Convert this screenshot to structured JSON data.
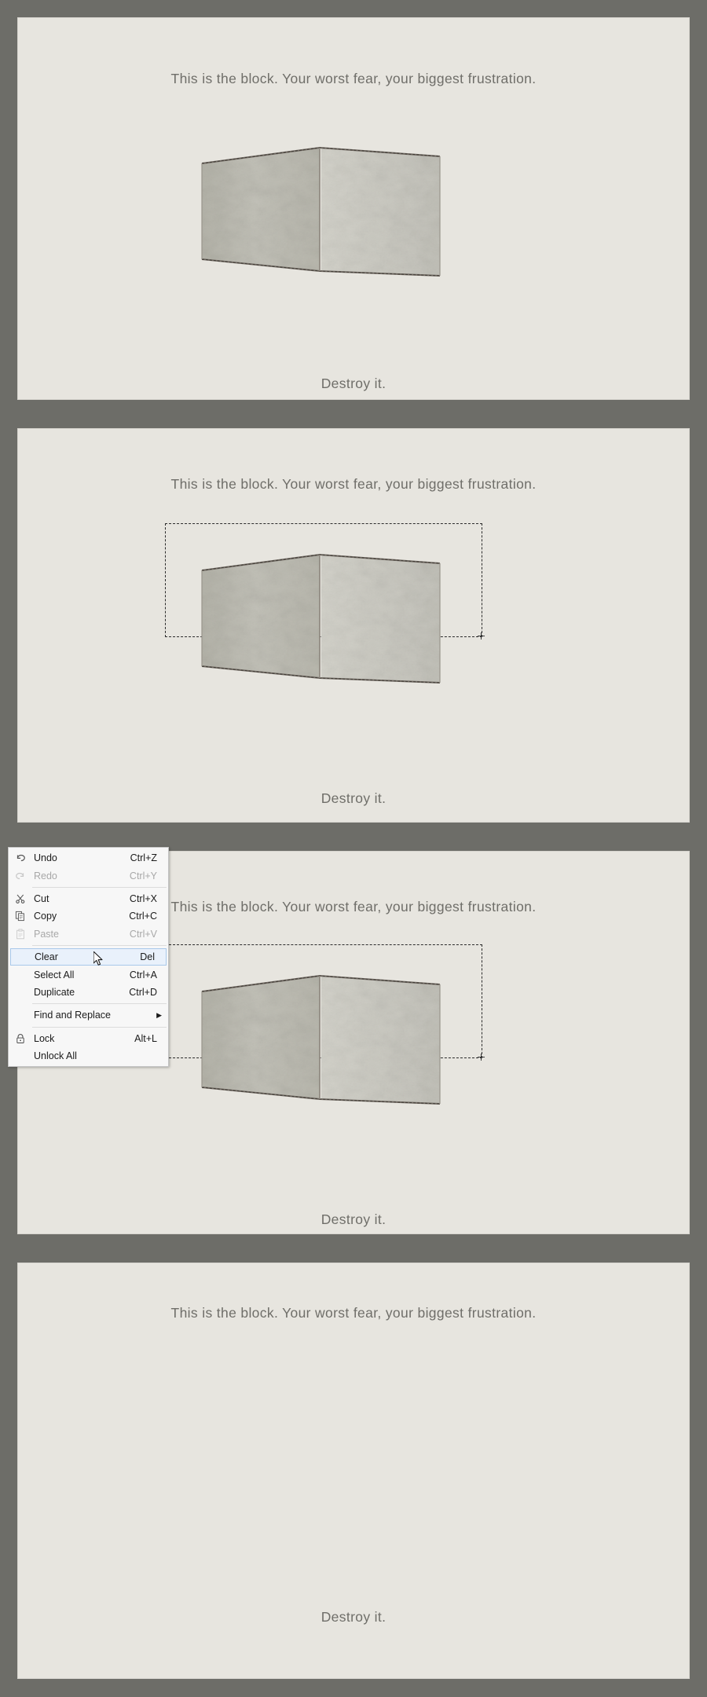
{
  "app": {
    "canvas_bg": "#e7e5df",
    "frame_bg": "#6d6d68",
    "text_color": "#6f6e69"
  },
  "panels": [
    {
      "id": "panel-1",
      "heading": "This is the block. Your worst fear, your biggest frustration.",
      "footer": "Destroy it.",
      "has_block": true,
      "has_selection": false
    },
    {
      "id": "panel-2",
      "heading": "This is the block. Your worst fear, your biggest frustration.",
      "footer": "Destroy it.",
      "has_block": true,
      "has_selection": true
    },
    {
      "id": "panel-3",
      "heading": "This is the block. Your worst fear, your biggest frustration.",
      "footer": "Destroy it.",
      "has_block": true,
      "has_selection": true
    },
    {
      "id": "panel-4",
      "heading": "This is the block. Your worst fear, your biggest frustration.",
      "footer": "Destroy it.",
      "has_block": false,
      "has_selection": false
    }
  ],
  "block": {
    "alt": "grey stone concrete block drawn in perspective",
    "face_left_color": "#bdbcb3",
    "face_right_color": "#cfcec6",
    "edge_color": "#6b645f"
  },
  "selection": {
    "style": "dashed",
    "color": "#2b2b2b",
    "handle": "resize-handle"
  },
  "context_menu": {
    "items": [
      {
        "icon": "undo-icon",
        "label": "Undo",
        "accel": "Ctrl+Z",
        "disabled": false,
        "selected": false,
        "submenu": false
      },
      {
        "icon": "redo-icon",
        "label": "Redo",
        "accel": "Ctrl+Y",
        "disabled": true,
        "selected": false,
        "submenu": false
      },
      {
        "separator": true
      },
      {
        "icon": "scissors-icon",
        "label": "Cut",
        "accel": "Ctrl+X",
        "disabled": false,
        "selected": false,
        "submenu": false
      },
      {
        "icon": "copy-icon",
        "label": "Copy",
        "accel": "Ctrl+C",
        "disabled": false,
        "selected": false,
        "submenu": false
      },
      {
        "icon": "paste-icon",
        "label": "Paste",
        "accel": "Ctrl+V",
        "disabled": true,
        "selected": false,
        "submenu": false
      },
      {
        "separator": true
      },
      {
        "icon": "",
        "label": "Clear",
        "accel": "Del",
        "disabled": false,
        "selected": true,
        "submenu": false
      },
      {
        "icon": "",
        "label": "Select All",
        "accel": "Ctrl+A",
        "disabled": false,
        "selected": false,
        "submenu": false
      },
      {
        "icon": "",
        "label": "Duplicate",
        "accel": "Ctrl+D",
        "disabled": false,
        "selected": false,
        "submenu": false
      },
      {
        "separator": true
      },
      {
        "icon": "",
        "label": "Find and Replace",
        "accel": "",
        "disabled": false,
        "selected": false,
        "submenu": true
      },
      {
        "separator": true
      },
      {
        "icon": "lock-icon",
        "label": "Lock",
        "accel": "Alt+L",
        "disabled": false,
        "selected": false,
        "submenu": false
      },
      {
        "icon": "",
        "label": "Unlock All",
        "accel": "",
        "disabled": false,
        "selected": false,
        "submenu": false
      }
    ],
    "highlight_color": "#e9f1fb",
    "highlight_border": "#a8c8ea"
  },
  "cursor": {
    "type": "arrow-pointer"
  }
}
